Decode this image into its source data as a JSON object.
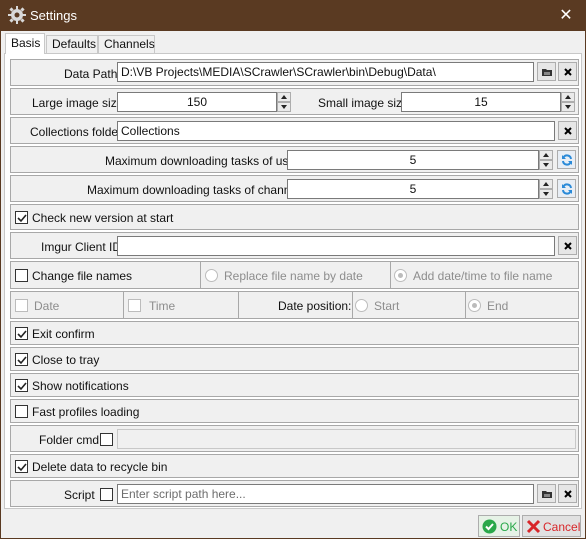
{
  "window": {
    "title": "Settings",
    "close_glyph": "✕"
  },
  "tabs": [
    {
      "label": "Basis"
    },
    {
      "label": "Defaults"
    },
    {
      "label": "Channels"
    }
  ],
  "basis": {
    "data_path": {
      "label": "Data Path",
      "value": "D:\\VB Projects\\MEDIA\\SCrawler\\SCrawler\\bin\\Debug\\Data\\"
    },
    "large_image_size": {
      "label": "Large image size",
      "value": "150"
    },
    "small_image_size": {
      "label": "Small image size",
      "value": "15"
    },
    "collections_folder": {
      "label": "Collections folder",
      "value": "Collections"
    },
    "max_tasks_users": {
      "label": "Maximum downloading tasks of users",
      "value": "5"
    },
    "max_tasks_channels": {
      "label": "Maximum downloading tasks of channels",
      "value": "5"
    },
    "check_new_version": {
      "label": "Check new version at start",
      "checked": true
    },
    "imgur_client_id": {
      "label": "Imgur Client ID",
      "value": ""
    },
    "change_file_names": {
      "label": "Change file names",
      "checked": false
    },
    "replace_file_name": {
      "label": "Replace file name by date",
      "selected": false
    },
    "add_date_time": {
      "label": "Add date/time to file name",
      "selected": true
    },
    "date_checkbox": {
      "label": "Date",
      "checked": false
    },
    "time_checkbox": {
      "label": "Time",
      "checked": false
    },
    "date_position": {
      "label": "Date position:",
      "start_label": "Start",
      "end_label": "End",
      "selected": "End"
    },
    "exit_confirm": {
      "label": "Exit confirm",
      "checked": true
    },
    "close_to_tray": {
      "label": "Close to tray",
      "checked": true
    },
    "show_notifications": {
      "label": "Show notifications",
      "checked": true
    },
    "fast_profiles_loading": {
      "label": "Fast profiles loading",
      "checked": false
    },
    "folder_cmd": {
      "label": "Folder cmd",
      "checked": false,
      "value": ""
    },
    "delete_to_recycle_bin": {
      "label": "Delete data to recycle bin",
      "checked": true
    },
    "script": {
      "label": "Script",
      "checked": false,
      "placeholder": "Enter script path here..."
    }
  },
  "footer": {
    "ok_label": "OK",
    "cancel_label": "Cancel"
  },
  "colors": {
    "titlebar": "#5a3a22",
    "ok_green": "#2aa84a",
    "cancel_red": "#d8262a",
    "refresh_blue": "#2a8ad8"
  }
}
